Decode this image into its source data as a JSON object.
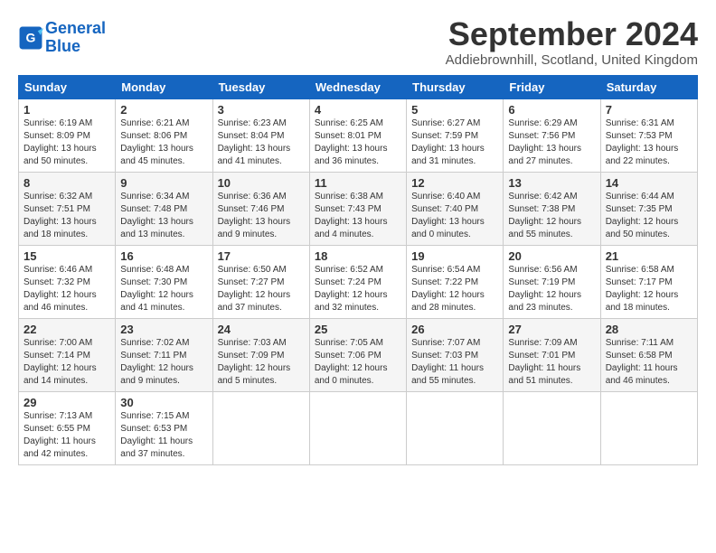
{
  "header": {
    "logo_line1": "General",
    "logo_line2": "Blue",
    "title": "September 2024",
    "location": "Addiebrownhill, Scotland, United Kingdom"
  },
  "weekdays": [
    "Sunday",
    "Monday",
    "Tuesday",
    "Wednesday",
    "Thursday",
    "Friday",
    "Saturday"
  ],
  "weeks": [
    [
      {
        "day": "1",
        "sunrise": "6:19 AM",
        "sunset": "8:09 PM",
        "daylight": "13 hours and 50 minutes."
      },
      {
        "day": "2",
        "sunrise": "6:21 AM",
        "sunset": "8:06 PM",
        "daylight": "13 hours and 45 minutes."
      },
      {
        "day": "3",
        "sunrise": "6:23 AM",
        "sunset": "8:04 PM",
        "daylight": "13 hours and 41 minutes."
      },
      {
        "day": "4",
        "sunrise": "6:25 AM",
        "sunset": "8:01 PM",
        "daylight": "13 hours and 36 minutes."
      },
      {
        "day": "5",
        "sunrise": "6:27 AM",
        "sunset": "7:59 PM",
        "daylight": "13 hours and 31 minutes."
      },
      {
        "day": "6",
        "sunrise": "6:29 AM",
        "sunset": "7:56 PM",
        "daylight": "13 hours and 27 minutes."
      },
      {
        "day": "7",
        "sunrise": "6:31 AM",
        "sunset": "7:53 PM",
        "daylight": "13 hours and 22 minutes."
      }
    ],
    [
      {
        "day": "8",
        "sunrise": "6:32 AM",
        "sunset": "7:51 PM",
        "daylight": "13 hours and 18 minutes."
      },
      {
        "day": "9",
        "sunrise": "6:34 AM",
        "sunset": "7:48 PM",
        "daylight": "13 hours and 13 minutes."
      },
      {
        "day": "10",
        "sunrise": "6:36 AM",
        "sunset": "7:46 PM",
        "daylight": "13 hours and 9 minutes."
      },
      {
        "day": "11",
        "sunrise": "6:38 AM",
        "sunset": "7:43 PM",
        "daylight": "13 hours and 4 minutes."
      },
      {
        "day": "12",
        "sunrise": "6:40 AM",
        "sunset": "7:40 PM",
        "daylight": "13 hours and 0 minutes."
      },
      {
        "day": "13",
        "sunrise": "6:42 AM",
        "sunset": "7:38 PM",
        "daylight": "12 hours and 55 minutes."
      },
      {
        "day": "14",
        "sunrise": "6:44 AM",
        "sunset": "7:35 PM",
        "daylight": "12 hours and 50 minutes."
      }
    ],
    [
      {
        "day": "15",
        "sunrise": "6:46 AM",
        "sunset": "7:32 PM",
        "daylight": "12 hours and 46 minutes."
      },
      {
        "day": "16",
        "sunrise": "6:48 AM",
        "sunset": "7:30 PM",
        "daylight": "12 hours and 41 minutes."
      },
      {
        "day": "17",
        "sunrise": "6:50 AM",
        "sunset": "7:27 PM",
        "daylight": "12 hours and 37 minutes."
      },
      {
        "day": "18",
        "sunrise": "6:52 AM",
        "sunset": "7:24 PM",
        "daylight": "12 hours and 32 minutes."
      },
      {
        "day": "19",
        "sunrise": "6:54 AM",
        "sunset": "7:22 PM",
        "daylight": "12 hours and 28 minutes."
      },
      {
        "day": "20",
        "sunrise": "6:56 AM",
        "sunset": "7:19 PM",
        "daylight": "12 hours and 23 minutes."
      },
      {
        "day": "21",
        "sunrise": "6:58 AM",
        "sunset": "7:17 PM",
        "daylight": "12 hours and 18 minutes."
      }
    ],
    [
      {
        "day": "22",
        "sunrise": "7:00 AM",
        "sunset": "7:14 PM",
        "daylight": "12 hours and 14 minutes."
      },
      {
        "day": "23",
        "sunrise": "7:02 AM",
        "sunset": "7:11 PM",
        "daylight": "12 hours and 9 minutes."
      },
      {
        "day": "24",
        "sunrise": "7:03 AM",
        "sunset": "7:09 PM",
        "daylight": "12 hours and 5 minutes."
      },
      {
        "day": "25",
        "sunrise": "7:05 AM",
        "sunset": "7:06 PM",
        "daylight": "12 hours and 0 minutes."
      },
      {
        "day": "26",
        "sunrise": "7:07 AM",
        "sunset": "7:03 PM",
        "daylight": "11 hours and 55 minutes."
      },
      {
        "day": "27",
        "sunrise": "7:09 AM",
        "sunset": "7:01 PM",
        "daylight": "11 hours and 51 minutes."
      },
      {
        "day": "28",
        "sunrise": "7:11 AM",
        "sunset": "6:58 PM",
        "daylight": "11 hours and 46 minutes."
      }
    ],
    [
      {
        "day": "29",
        "sunrise": "7:13 AM",
        "sunset": "6:55 PM",
        "daylight": "11 hours and 42 minutes."
      },
      {
        "day": "30",
        "sunrise": "7:15 AM",
        "sunset": "6:53 PM",
        "daylight": "11 hours and 37 minutes."
      },
      null,
      null,
      null,
      null,
      null
    ]
  ]
}
